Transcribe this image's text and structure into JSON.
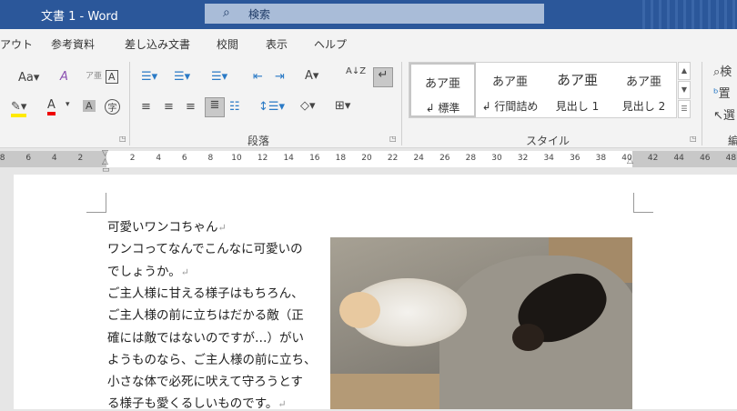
{
  "titlebar": {
    "title": "文書 1  -  Word",
    "search_placeholder": "検索"
  },
  "tabs": [
    "アウト",
    "参考資料",
    "差し込み文書",
    "校閲",
    "表示",
    "ヘルプ"
  ],
  "ribbon": {
    "font_group": {
      "change_case": "Aa",
      "phonetic": "ア亜",
      "char_border": "A",
      "shade_char": "A",
      "enclosed": "字",
      "font_color": "A"
    },
    "paragraph_group": {
      "label": "段落",
      "sort": "A↓Z"
    },
    "styles_group": {
      "label": "スタイル",
      "styles": [
        {
          "preview": "あア亜",
          "name": "↲ 標準",
          "selected": true
        },
        {
          "preview": "あア亜",
          "name": "↲ 行間詰め"
        },
        {
          "preview": "あア亜",
          "name": "見出し 1"
        },
        {
          "preview": "あア亜",
          "name": "見出し 2"
        }
      ]
    },
    "editing_group": {
      "items": [
        "検",
        "置",
        "選"
      ],
      "label": "編"
    }
  },
  "ruler": {
    "left": [
      "8",
      "6",
      "4",
      "2"
    ],
    "main": [
      "2",
      "4",
      "6",
      "8",
      "10",
      "12",
      "14",
      "16",
      "18",
      "20",
      "22",
      "24",
      "26",
      "28",
      "30",
      "32",
      "34",
      "36",
      "38",
      "40"
    ],
    "right": [
      "42",
      "44",
      "46",
      "48"
    ]
  },
  "document": {
    "lines": [
      "可愛いワンコちゃん",
      "ワンコってなんでこんなに可愛いの",
      "でしょうか。",
      "ご主人様に甘える様子はもちろん、",
      "ご主人様の前に立ちはだかる敵（正",
      "確には敵ではないのですが…）がい",
      "ようものなら、ご主人様の前に立ち、",
      "小さな体で必死に吠えて守ろうとす",
      "る様子も愛くるしいものです。"
    ],
    "para_marks": [
      0,
      2,
      8
    ],
    "para_mark": "↵"
  }
}
